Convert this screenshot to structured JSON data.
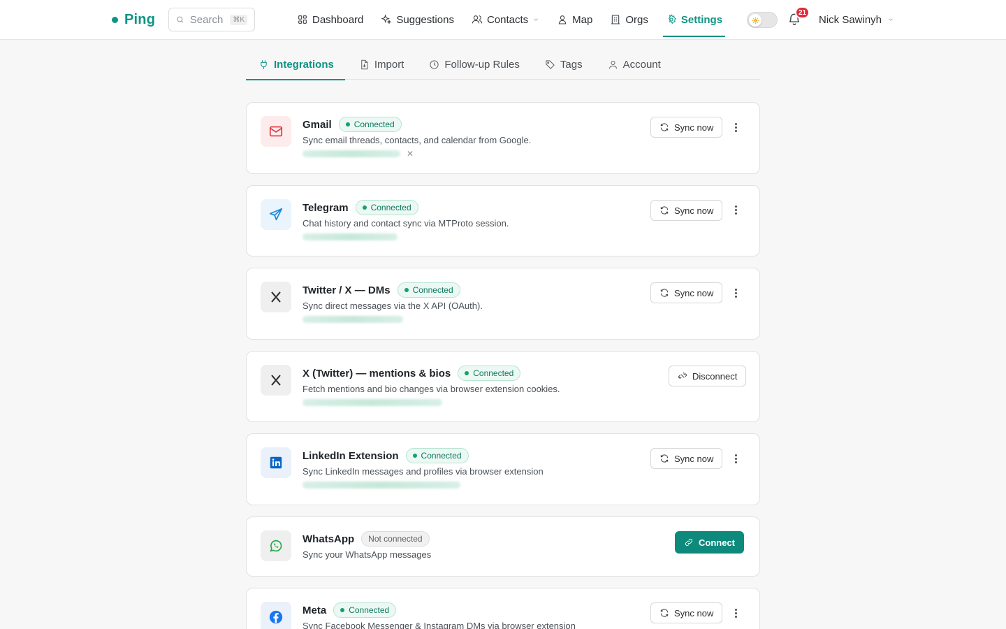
{
  "app": {
    "name": "Ping",
    "brand_color": "#0e9384"
  },
  "search": {
    "placeholder": "Search",
    "shortcut": "⌘K"
  },
  "nav": [
    {
      "label": "Dashboard",
      "icon": "dashboard-icon"
    },
    {
      "label": "Suggestions",
      "icon": "sparkles-icon"
    },
    {
      "label": "Contacts",
      "icon": "users-icon"
    },
    {
      "label": "Map",
      "icon": "map-pin-icon"
    },
    {
      "label": "Orgs",
      "icon": "building-icon"
    },
    {
      "label": "Settings",
      "icon": "gear-icon",
      "active": true
    }
  ],
  "notifications": {
    "count": "21"
  },
  "user": {
    "name": "Nick Sawinyh"
  },
  "subtabs": [
    {
      "label": "Integrations",
      "icon": "plug-icon",
      "active": true
    },
    {
      "label": "Import",
      "icon": "file-import-icon"
    },
    {
      "label": "Follow-up Rules",
      "icon": "clock-icon"
    },
    {
      "label": "Tags",
      "icon": "tag-icon"
    },
    {
      "label": "Account",
      "icon": "user-icon"
    }
  ],
  "integrations": [
    {
      "name": "Gmail",
      "status": "Connected",
      "description": "Sync email threads, contacts, and calendar from Google.",
      "action": "Sync now",
      "icon": "mail-icon"
    },
    {
      "name": "Telegram",
      "status": "Connected",
      "description": "Chat history and contact sync via MTProto session.",
      "action": "Sync now",
      "icon": "send-icon"
    },
    {
      "name": "Twitter / X — DMs",
      "status": "Connected",
      "description": "Sync direct messages via the X API (OAuth).",
      "action": "Sync now",
      "icon": "x-logo-icon"
    },
    {
      "name": "X (Twitter) — mentions & bios",
      "status": "Connected",
      "description": "Fetch mentions and bio changes via browser extension cookies.",
      "action": "Disconnect",
      "icon": "x-logo-icon"
    },
    {
      "name": "LinkedIn Extension",
      "status": "Connected",
      "description": "Sync LinkedIn messages and profiles via browser extension",
      "action": "Sync now",
      "icon": "linkedin-icon"
    },
    {
      "name": "WhatsApp",
      "status": "Not connected",
      "description": "Sync your WhatsApp messages",
      "action": "Connect",
      "icon": "whatsapp-icon"
    },
    {
      "name": "Meta",
      "status": "Connected",
      "description": "Sync Facebook Messenger & Instagram DMs via browser extension",
      "action": "Sync now",
      "icon": "facebook-icon"
    }
  ]
}
